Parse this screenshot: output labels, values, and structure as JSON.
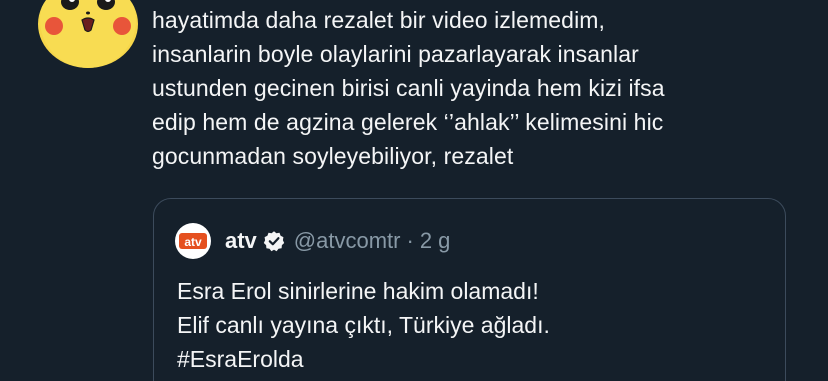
{
  "tweet": {
    "text": "hayatimda daha rezalet bir video izlemedim,\ninsanlarin boyle olaylarini pazarlayarak insanlar\nustunden gecinen birisi canli yayinda hem kizi ifsa\nedip hem de agzina gelerek ‘’ahlak’’ kelimesini hic\ngocunmadan soyleyebiliyor, rezalet",
    "avatar_icon": "pikachu-avatar-icon"
  },
  "quote": {
    "logo_text": "atv",
    "name": "atv",
    "handle": "@atvcomtr",
    "separator": "·",
    "time": "2 g",
    "verified_icon": "verified-badge-icon",
    "body": "Esra Erol sinirlerine hakim olamadı!\nElif canlı yayına çıktı, Türkiye ağladı.\n#EsraErolda"
  },
  "colors": {
    "background": "#15202b",
    "text": "#f4f5f6",
    "secondary_text": "#8899a6",
    "card_border": "#3c4b5c",
    "atv_brand": "#e5501f"
  }
}
